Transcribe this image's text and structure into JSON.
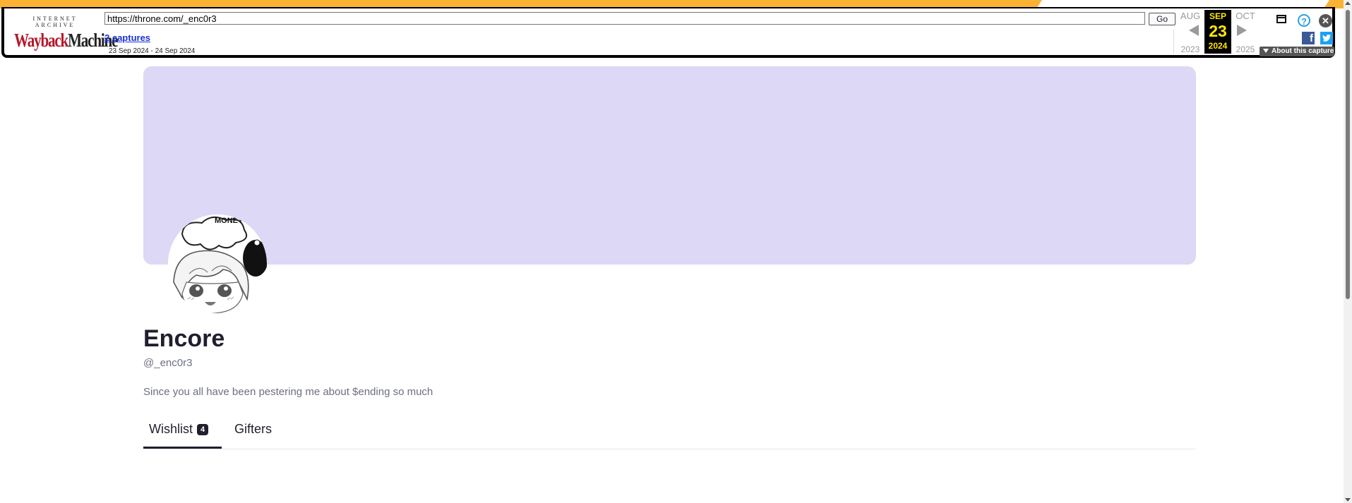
{
  "wayback": {
    "logo_top": "INTERNET ARCHIVE",
    "logo_word1": "Wayback",
    "logo_word2": "Machine",
    "url": "https://throne.com/_enc0r3",
    "go_label": "Go",
    "captures_label": "2 captures",
    "date_range": "23 Sep 2024 - 24 Sep 2024",
    "prev_month": "AUG",
    "prev_year": "2023",
    "cur_month": "SEP",
    "cur_day": "23",
    "cur_year": "2024",
    "next_month": "OCT",
    "next_year": "2025",
    "help_glyph": "?",
    "close_glyph": "✕",
    "facebook_glyph": "f",
    "twitter_glyph": "t",
    "about_label": "About this capture",
    "accent_color": "#f9b233"
  },
  "profile": {
    "name": "Encore",
    "handle": "@_enc0r3",
    "bio": "Since you all have been pestering me about $ending so much",
    "avatar_caption": "MONEY",
    "banner_color": "#ddd8f6"
  },
  "tabs": {
    "wishlist_label": "Wishlist",
    "wishlist_count": "4",
    "gifters_label": "Gifters"
  },
  "icons": {
    "calendar_icon": "calendar-icon",
    "help_icon": "help-icon",
    "close_icon": "close-icon",
    "facebook_icon": "facebook-icon",
    "twitter_icon": "twitter-icon"
  }
}
